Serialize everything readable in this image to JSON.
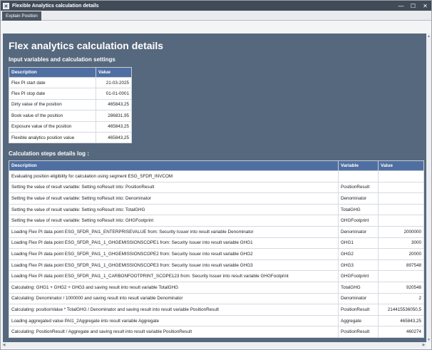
{
  "window": {
    "title": "Flexible Analytics calculation details",
    "icon": "app-window-icon",
    "controls": {
      "minimize": "—",
      "maximize": "☐",
      "close": "✕"
    }
  },
  "tabs": [
    {
      "label": "Explain Position",
      "active": true
    }
  ],
  "page": {
    "title": "Flex analytics calculation details",
    "input_section_title": "Input variables and calculation settings",
    "log_section_title": "Calculation steps details log :"
  },
  "inputs": {
    "columns": [
      "Description",
      "Value"
    ],
    "rows": [
      {
        "description": "Flex PI start date",
        "value": "21-03-2025"
      },
      {
        "description": "Flex PI stop date",
        "value": "01-01-0001"
      },
      {
        "description": "Dirty value of the position",
        "value": "465843,25"
      },
      {
        "description": "Book value of the position",
        "value": "286831,95"
      },
      {
        "description": "Exposure value of the position",
        "value": "465843,25"
      },
      {
        "description": "Flexible analytics position value",
        "value": "465843,25"
      }
    ]
  },
  "log": {
    "columns": [
      "Description",
      "Variable",
      "Value"
    ],
    "rows": [
      {
        "description": "Evaluating position eligibility for calculation using segment ESG_SFDR_INVCOM",
        "variable": "",
        "value": ""
      },
      {
        "description": "Setting the value of result variable: Setting noResult into: PositionResult",
        "variable": "PositionResult",
        "value": ""
      },
      {
        "description": "Setting the value of result variable: Setting noResult into: Denominator",
        "variable": "Denominator",
        "value": ""
      },
      {
        "description": "Setting the value of result variable: Setting noResult into: TotalGHG",
        "variable": "TotalGHG",
        "value": ""
      },
      {
        "description": "Setting the value of result variable: Setting noResult into: GHGFootprint",
        "variable": "GHGFootprint",
        "value": ""
      },
      {
        "description": "Loading Flex PI data point ESG_SFDR_PAI1_ENTERPRISEVALUE from: Security Issuer into result variable Denominator",
        "variable": "Denominator",
        "value": "2000000"
      },
      {
        "description": "Loading Flex PI data point ESG_SFDR_PAI1_1_GHGEMISSIONSCOPE1 from: Security Issuer into result variable GHG1",
        "variable": "GHG1",
        "value": "3000"
      },
      {
        "description": "Loading Flex PI data point ESG_SFDR_PAI1_1_GHGEMISSIONSCOPE2 from: Security Issuer into result variable GHG2",
        "variable": "GHG2",
        "value": "20000"
      },
      {
        "description": "Loading Flex PI data point ESG_SFDR_PAI1_1_GHGEMISSIONSCOPE3 from: Security Issuer into result variable GHG3",
        "variable": "GHG3",
        "value": "897548"
      },
      {
        "description": "Loading Flex PI data point ESG_SFDR_PAI1_1_CARBONFOOTPRINT_SCOPE123 from: Security Issuer into result variable GHGFootprint",
        "variable": "GHGFootprint",
        "value": ""
      },
      {
        "description": "Calculating: GHG1 + GHG2 + GHG3 and saving result into result variable TotalGHG",
        "variable": "TotalGHG",
        "value": "920548"
      },
      {
        "description": "Calculating: Denominator / 1000000 and saving result into result variable Denominator",
        "variable": "Denominator",
        "value": "2"
      },
      {
        "description": "Calculating: positionValue * TotalGHG / Denominator and saving result into result variable PositionResult",
        "variable": "PositionResult",
        "value": "214415536050,5"
      },
      {
        "description": "Loading aggregated value PAI1_2Aggregate into result variable Aggregate",
        "variable": "Aggregate",
        "value": "465843,25"
      },
      {
        "description": "Calculating: PositionResult / Aggregate and saving result into result variable PositionResult",
        "variable": "PositionResult",
        "value": "460274"
      }
    ]
  },
  "scrollbars": {
    "up": "▲",
    "down": "▼",
    "left": "◀",
    "right": "▶"
  }
}
